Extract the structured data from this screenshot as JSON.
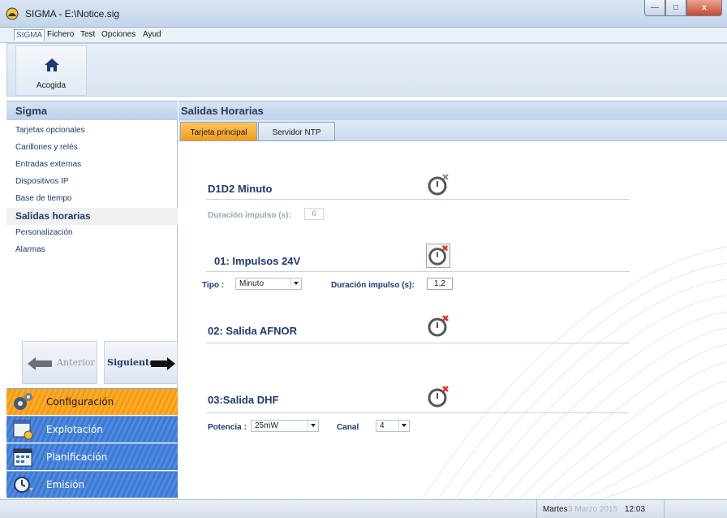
{
  "window": {
    "title": "SIGMA - E:\\Notice.sig"
  },
  "menu": {
    "items": [
      "SIGMA",
      "Fichero",
      "Test",
      "Opciones",
      "Ayud"
    ]
  },
  "ribbon": {
    "home_label": "Acogida"
  },
  "sidebar": {
    "title": "Sigma",
    "items": [
      {
        "label": "Tarjetas opcionales"
      },
      {
        "label": "Carillones y relés"
      },
      {
        "label": "Entradas externas"
      },
      {
        "label": "Dispositivos IP"
      },
      {
        "label": "Base de tiempo"
      },
      {
        "label": "Salidas horarias",
        "active": true
      },
      {
        "label": "Personalización"
      },
      {
        "label": "Alarmas"
      }
    ],
    "prev_label": "Anterior",
    "next_label": "Siguiente.",
    "modules": [
      {
        "label": "Configuración",
        "active": true,
        "icon": "gears-icon"
      },
      {
        "label": "Explotación",
        "active": false,
        "icon": "window-gear-icon"
      },
      {
        "label": "Planificación",
        "active": false,
        "icon": "calendar-icon"
      },
      {
        "label": "Emisión",
        "active": false,
        "icon": "clock-arrow-icon"
      }
    ]
  },
  "main": {
    "title": "Salidas Horarias",
    "tabs": [
      {
        "label": "Tarjeta principal",
        "active": true
      },
      {
        "label": "Servidor NTP",
        "active": false
      }
    ],
    "sections": [
      {
        "title": "D1D2 Minuto",
        "status_icon": "clock-disabled-icon"
      },
      {
        "title": "01: Impulsos 24V",
        "status_icon": "clock-error-icon"
      },
      {
        "title": "02: Salida AFNOR",
        "status_icon": "clock-error-icon"
      },
      {
        "title": "03:Salida DHF",
        "status_icon": "clock-error-icon"
      }
    ],
    "d1d2": {
      "pulse_label": "Duración impulso (s):",
      "pulse_value": "6"
    },
    "out01": {
      "type_label": "Tipo :",
      "type_value": "Minuto",
      "pulse_label": "Duración impulso (s):",
      "pulse_value": "1,2"
    },
    "out03": {
      "power_label": "Potencia :",
      "power_value": "25mW",
      "channel_label": "Canal",
      "channel_value": "4"
    }
  },
  "status": {
    "day": "Martes",
    "date": "3 Marzo 2015",
    "time": "12:03"
  },
  "colors": {
    "accent_orange": "#f59a10",
    "accent_blue": "#3d78d2",
    "title_blue": "#1f3a6e",
    "error_red": "#e0302a"
  }
}
